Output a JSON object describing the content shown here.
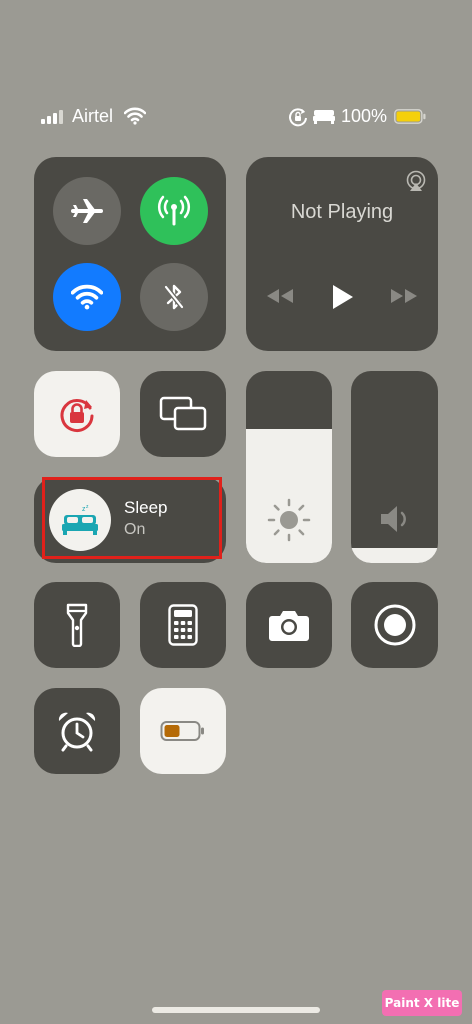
{
  "status_bar": {
    "carrier": "Airtel",
    "battery_percent": "100%",
    "icons": [
      "cellular-signal-icon",
      "wifi-icon",
      "orientation-lock-icon",
      "sleep-bed-icon",
      "battery-icon"
    ]
  },
  "connectivity": {
    "airplane_mode": false,
    "cellular_data": true,
    "wifi": true,
    "bluetooth": false
  },
  "now_playing": {
    "status": "Not Playing",
    "icons": [
      "airplay-icon",
      "rewind-icon",
      "play-icon",
      "fast-forward-icon"
    ]
  },
  "focus": {
    "label": "Sleep",
    "state": "On"
  },
  "brightness_level": 0.7,
  "volume_level": 0.08,
  "colors": {
    "background": "#9b9a93",
    "tile": "#4a4944",
    "active_green": "#2fc15a",
    "active_blue": "#127bff",
    "lock_red": "#d9363e",
    "sleep_teal": "#1aa6b2",
    "battery_yellow": "#f5d00b",
    "highlight_red": "#e0211b"
  },
  "watermark": "Paint X lite"
}
